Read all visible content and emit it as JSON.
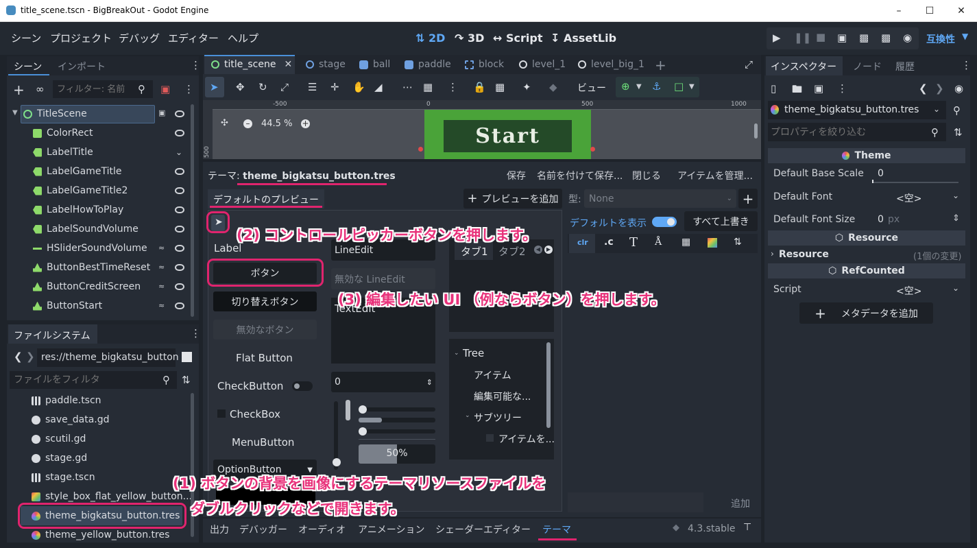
{
  "window": {
    "title": "title_scene.tscn - BigBreakOut - Godot Engine"
  },
  "menu": [
    "シーン",
    "プロジェクト",
    "デバッグ",
    "エディター",
    "ヘルプ"
  ],
  "modes": {
    "m2d": "2D",
    "m3d": "3D",
    "script": "Script",
    "assetlib": "AssetLib"
  },
  "compat": "互換性",
  "scene_dock": {
    "tabs": [
      "シーン",
      "インポート"
    ],
    "filter_placeholder": "フィルター: 名前",
    "nodes": [
      {
        "name": "TitleScene",
        "color": "#7fe08a"
      },
      {
        "name": "ColorRect",
        "color": "#8eda6a"
      },
      {
        "name": "LabelTitle",
        "color": "#8eda6a"
      },
      {
        "name": "LabelGameTitle",
        "color": "#8eda6a"
      },
      {
        "name": "LabelGameTitle2",
        "color": "#8eda6a"
      },
      {
        "name": "LabelHowToPlay",
        "color": "#8eda6a"
      },
      {
        "name": "LabelSoundVolume",
        "color": "#8eda6a"
      },
      {
        "name": "HSliderSoundVolume",
        "color": "#8eda6a"
      },
      {
        "name": "ButtonBestTimeReset",
        "color": "#8eda6a"
      },
      {
        "name": "ButtonCreditScreen",
        "color": "#8eda6a"
      },
      {
        "name": "ButtonStart",
        "color": "#8eda6a"
      }
    ]
  },
  "fs_dock": {
    "title": "ファイルシステム",
    "path": "res://theme_bigkatsu_button",
    "filter_placeholder": "ファイルをフィルタ",
    "files": [
      "paddle.tscn",
      "save_data.gd",
      "scutil.gd",
      "stage.gd",
      "stage.tscn",
      "style_box_flat_yellow_button...",
      "theme_bigkatsu_button.tres",
      "theme_yellow_button.tres"
    ]
  },
  "scene_tabs": [
    "title_scene",
    "stage",
    "ball",
    "paddle",
    "block",
    "level_1",
    "level_big_1"
  ],
  "viewport": {
    "ruler": [
      "-500",
      "0",
      "500",
      "1000"
    ],
    "ruler_v": "500",
    "zoom": "44.5 %",
    "start_label": "Start",
    "view_label": "ビュー"
  },
  "theme_editor": {
    "title_prefix": "テーマ:",
    "file": "theme_bigkatsu_button.tres",
    "actions": [
      "保存",
      "名前を付けて保存...",
      "閉じる",
      "アイテムを管理..."
    ],
    "preview_tab": "デフォルトのプレビュー",
    "add_preview": "プレビューを追加",
    "type_label": "型:",
    "type_value": "None",
    "show_default": "デフォルトを表示",
    "override_all": "すべて上書き",
    "add_label": "追加",
    "preview": {
      "label": "Label",
      "button": "ボタン",
      "toggle_button": "切り替えボタン",
      "disabled_button": "無効なボタン",
      "flat_button": "Flat Button",
      "check_button": "CheckButton",
      "check_box": "CheckBox",
      "menu_button": "MenuButton",
      "option_button": "OptionButton",
      "lineedit": "LineEdit",
      "lineedit_disabled": "無効な LineEdit",
      "textedit": "TextEdit",
      "spin_value": "0",
      "progress": "50%",
      "tab1": "タブ1",
      "tab2": "タブ2",
      "tree": [
        "Tree",
        "アイテム",
        "編集可能な...",
        "サブツリー",
        "アイテムを..."
      ]
    }
  },
  "bottom_tabs": [
    "出力",
    "デバッガー",
    "オーディオ",
    "アニメーション",
    "シェーダーエディター",
    "テーマ"
  ],
  "version": "4.3.stable",
  "inspector": {
    "tabs": [
      "インスペクター",
      "ノード",
      "履歴"
    ],
    "resource": "theme_bigkatsu_button.tres",
    "filter_placeholder": "プロパティを絞り込む",
    "sections": [
      "Theme",
      "Resource",
      "RefCounted"
    ],
    "rows": [
      {
        "label": "Default Base Scale",
        "value": "0"
      },
      {
        "label": "Default Font",
        "value": "<空>"
      },
      {
        "label": "Default Font Size",
        "value": "0",
        "unit": "px"
      }
    ],
    "resource_row": {
      "label": "Resource",
      "value": "(1個の変更)"
    },
    "script_row": {
      "label": "Script",
      "value": "<空>"
    },
    "add_meta": "メタデータを追加"
  },
  "callouts": {
    "c1a": "(1) ボタンの背景を画像にするテーマリソースファイルを",
    "c1b": "ダブルクリックなどで開きます。",
    "c2": "(2) コントロールピッカーボタンを押します。",
    "c3": "(3) 編集したい UI （例ならボタン）を押します。"
  },
  "colors": {
    "accent": "#e0246e",
    "godot_blue": "#4a90d9",
    "start_green": "#4aa339"
  }
}
